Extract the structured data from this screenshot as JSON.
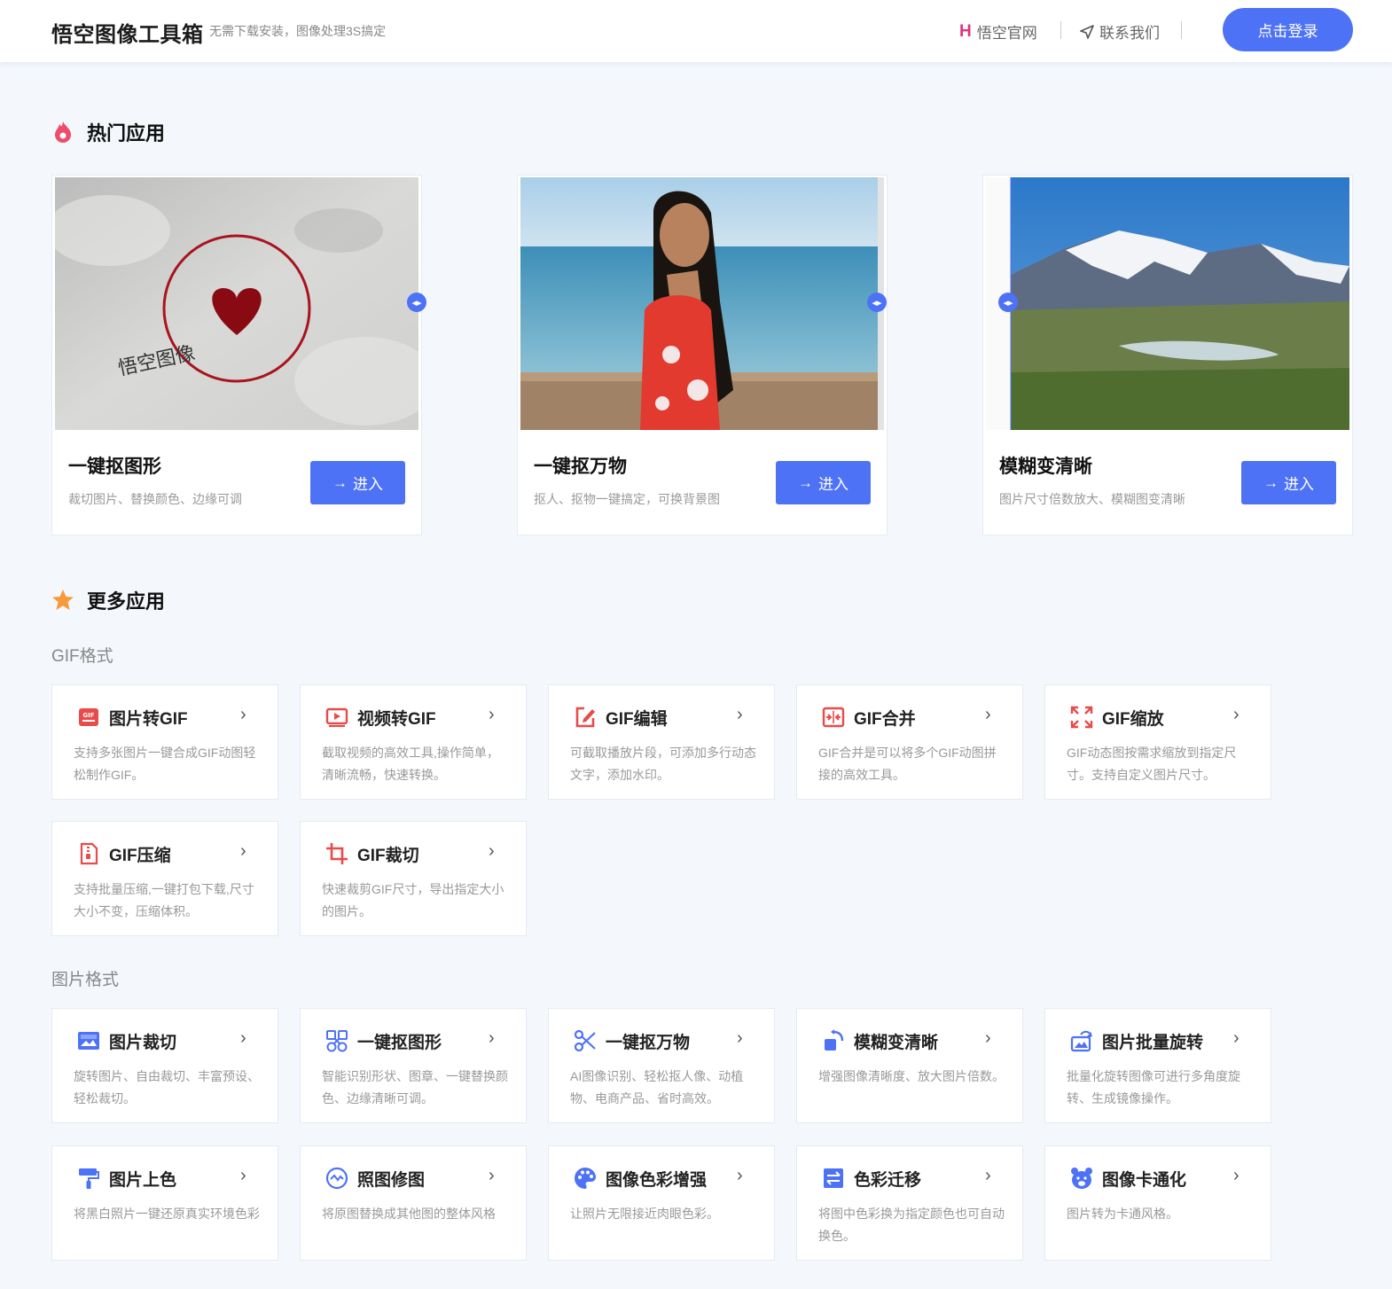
{
  "header": {
    "logo": "悟空图像工具箱",
    "slogan": "无需下载安装，图像处理3S搞定",
    "nav_site": "悟空官网",
    "nav_contact": "联系我们",
    "login_label": "点击登录"
  },
  "hot": {
    "title": "热门应用",
    "cards": [
      {
        "title": "一键抠图形",
        "desc": "裁切图片、替换颜色、边缘可调",
        "enter": "进入",
        "stamp_text": "悟空图像"
      },
      {
        "title": "一键抠万物",
        "desc": "抠人、抠物一键搞定，可换背景图",
        "enter": "进入"
      },
      {
        "title": "模糊变清晰",
        "desc": "图片尺寸倍数放大、模糊图变清晰",
        "enter": "进入"
      }
    ]
  },
  "more": {
    "title": "更多应用",
    "groups": [
      {
        "label": "GIF格式",
        "apps": [
          {
            "name": "图片转GIF",
            "desc": "支持多张图片一键合成GIF动图轻松制作GIF。",
            "icon": "image-to-gif-icon"
          },
          {
            "name": "视频转GIF",
            "desc": "截取视频的高效工具,操作简单，清晰流畅，快速转换。",
            "icon": "video-to-gif-icon"
          },
          {
            "name": "GIF编辑",
            "desc": "可截取播放片段，可添加多行动态文字，添加水印。",
            "icon": "edit-icon"
          },
          {
            "name": "GIF合并",
            "desc": "GIF合并是可以将多个GIF动图拼接的高效工具。",
            "icon": "merge-icon"
          },
          {
            "name": "GIF缩放",
            "desc": "GIF动态图按需求缩放到指定尺寸。支持自定义图片尺寸。",
            "icon": "resize-icon"
          },
          {
            "name": "GIF压缩",
            "desc": "支持批量压缩,一键打包下载,尺寸大小不变，压缩体积。",
            "icon": "compress-icon"
          },
          {
            "name": "GIF裁切",
            "desc": "快速裁剪GIF尺寸，导出指定大小的图片。",
            "icon": "crop-icon"
          }
        ]
      },
      {
        "label": "图片格式",
        "apps": [
          {
            "name": "图片裁切",
            "desc": "旋转图片、自由裁切、丰富预设、轻松裁切。",
            "icon": "image-crop-icon"
          },
          {
            "name": "一键抠图形",
            "desc": "智能识别形状、图章、一键替换颜色、边缘清晰可调。",
            "icon": "shape-cutout-icon"
          },
          {
            "name": "一键抠万物",
            "desc": "AI图像识别、轻松抠人像、动植物、电商产品、省时高效。",
            "icon": "scissors-icon"
          },
          {
            "name": "模糊变清晰",
            "desc": "增强图像清晰度、放大图片倍数。",
            "icon": "enhance-icon"
          },
          {
            "name": "图片批量旋转",
            "desc": "批量化旋转图像可进行多角度旋转、生成镜像操作。",
            "icon": "rotate-icon"
          },
          {
            "name": "图片上色",
            "desc": "将黑白照片一键还原真实环境色彩",
            "icon": "paint-roller-icon"
          },
          {
            "name": "照图修图",
            "desc": "将原图替换成其他图的整体风格",
            "icon": "style-icon"
          },
          {
            "name": "图像色彩增强",
            "desc": "让照片无限接近肉眼色彩。",
            "icon": "palette-icon"
          },
          {
            "name": "色彩迁移",
            "desc": "将图中色彩换为指定颜色也可自动换色。",
            "icon": "transfer-icon"
          },
          {
            "name": "图像卡通化",
            "desc": "图片转为卡通风格。",
            "icon": "cartoon-bear-icon"
          }
        ]
      }
    ]
  },
  "colors": {
    "accent": "#4e72f5",
    "red_icon": "#e94a4a",
    "blue_icon": "#4e72f5",
    "background": "#f4f8fd"
  }
}
